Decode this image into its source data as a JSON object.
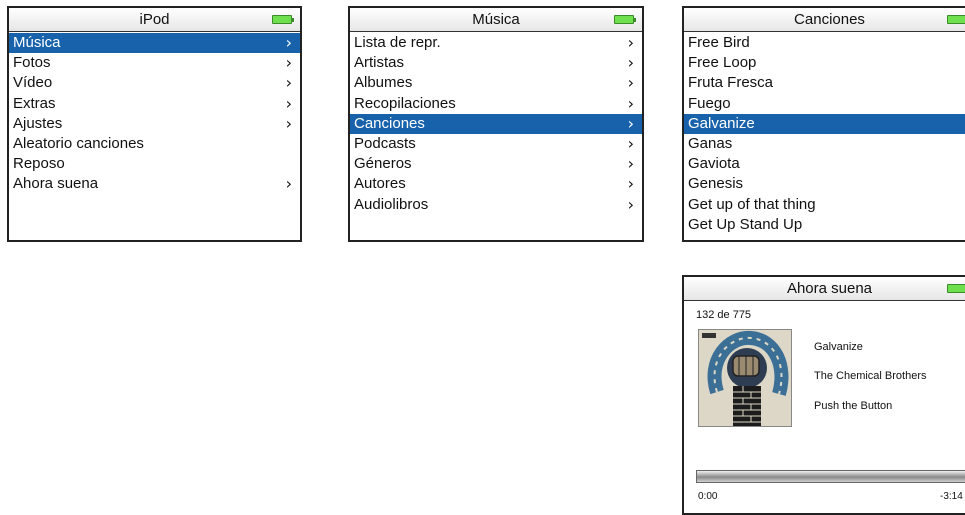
{
  "screens": {
    "ipod": {
      "title": "iPod",
      "items": [
        {
          "label": "Música",
          "selected": true,
          "arrow": true
        },
        {
          "label": "Fotos",
          "arrow": true
        },
        {
          "label": "Vídeo",
          "arrow": true
        },
        {
          "label": "Extras",
          "arrow": true
        },
        {
          "label": "Ajustes",
          "arrow": true
        },
        {
          "label": "Aleatorio canciones",
          "arrow": false
        },
        {
          "label": "Reposo",
          "arrow": false
        },
        {
          "label": "Ahora suena",
          "arrow": true
        }
      ]
    },
    "musica": {
      "title": "Música",
      "items": [
        {
          "label": "Lista de repr.",
          "arrow": true
        },
        {
          "label": "Artistas",
          "arrow": true
        },
        {
          "label": "Albumes",
          "arrow": true
        },
        {
          "label": "Recopilaciones",
          "arrow": true
        },
        {
          "label": "Canciones",
          "selected": true,
          "arrow": true
        },
        {
          "label": "Podcasts",
          "arrow": true
        },
        {
          "label": "Géneros",
          "arrow": true
        },
        {
          "label": "Autores",
          "arrow": true
        },
        {
          "label": "Audiolibros",
          "arrow": true
        }
      ]
    },
    "canciones": {
      "title": "Canciones",
      "items": [
        {
          "label": "Free Bird"
        },
        {
          "label": "Free Loop"
        },
        {
          "label": "Fruta Fresca"
        },
        {
          "label": "Fuego"
        },
        {
          "label": "Galvanize",
          "selected": true
        },
        {
          "label": "Ganas"
        },
        {
          "label": "Gaviota"
        },
        {
          "label": "Genesis"
        },
        {
          "label": "Get up of that thing"
        },
        {
          "label": "Get Up Stand Up"
        }
      ]
    },
    "ahora_suena": {
      "title": "Ahora suena",
      "count": "132 de 775",
      "song": "Galvanize",
      "artist": "The Chemical Brothers",
      "album": "Push the Button",
      "elapsed": "0:00",
      "remaining": "-3:14",
      "progress_fraction": 0.0,
      "album_art_icon": "album-art-push-the-button"
    }
  },
  "icons": {
    "battery": "battery-full-icon",
    "chevron": "›"
  },
  "colors": {
    "selection": "#1762aa",
    "battery": "#6ee04e"
  }
}
